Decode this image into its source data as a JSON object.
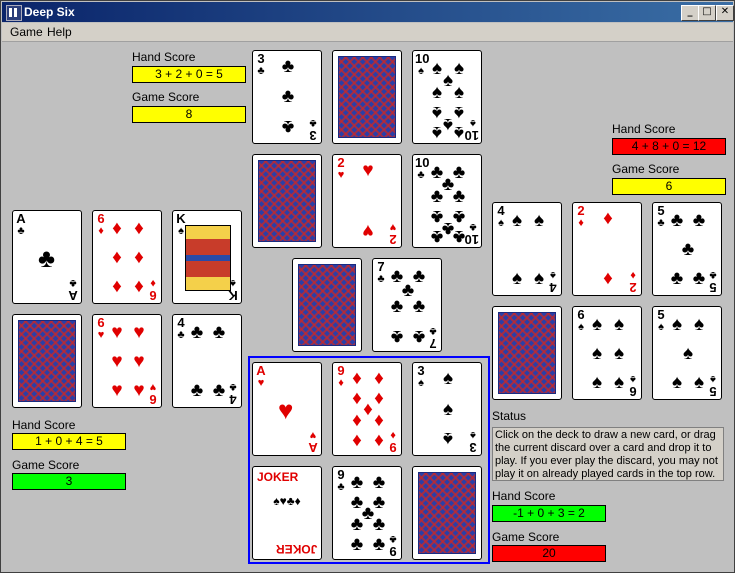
{
  "window": {
    "title": "Deep Six"
  },
  "menu": {
    "game": "Game",
    "help": "Help"
  },
  "buttons": {
    "minimize": "_",
    "maximize": "□",
    "close": "✕"
  },
  "player_top": {
    "hand_label": "Hand Score",
    "hand_value": "3 + 2 + 0 = 5",
    "game_label": "Game Score",
    "game_value": "8"
  },
  "player_right": {
    "hand_label": "Hand Score",
    "hand_value": "4 + 8 + 0 = 12",
    "game_label": "Game Score",
    "game_value": "6"
  },
  "player_left": {
    "hand_label": "Hand Score",
    "hand_value": "1 + 0 + 4 = 5",
    "game_label": "Game Score",
    "game_value": "3"
  },
  "player_bottom": {
    "hand_label": "Hand Score",
    "hand_value": "-1 + 0 + 3 = 2",
    "game_label": "Game Score",
    "game_value": "20"
  },
  "status": {
    "label": "Status",
    "text": "Click on the deck to draw a new card, or drag the current discard over a card and drop it to play. If you ever play the discard, you may not play it on already played cards in the top row."
  },
  "cards": {
    "top_1": {
      "rank": "3",
      "suit": "♣"
    },
    "top_3": {
      "rank": "10",
      "suit": "♠"
    },
    "mid_2": {
      "rank": "2",
      "suit": "♥"
    },
    "mid_3": {
      "rank": "10",
      "suit": "♣"
    },
    "center_2": {
      "rank": "7",
      "suit": "♣"
    },
    "left_1": {
      "rank": "A",
      "suit": "♣"
    },
    "left_2": {
      "rank": "6",
      "suit": "♦"
    },
    "left_3": {
      "rank": "K",
      "suit": "♠"
    },
    "left_5": {
      "rank": "6",
      "suit": "♥"
    },
    "left_6": {
      "rank": "4",
      "suit": "♣"
    },
    "right_1": {
      "rank": "4",
      "suit": "♠"
    },
    "right_2": {
      "rank": "2",
      "suit": "♦"
    },
    "right_3": {
      "rank": "5",
      "suit": "♣"
    },
    "right_5": {
      "rank": "6",
      "suit": "♠"
    },
    "right_6": {
      "rank": "5",
      "suit": "♠"
    },
    "bottom_1": {
      "rank": "A",
      "suit": "♥"
    },
    "bottom_2": {
      "rank": "9",
      "suit": "♦"
    },
    "bottom_3": {
      "rank": "3",
      "suit": "♠"
    },
    "bottom_4": {
      "rank": "JOKER",
      "suit": "♠♥♣♦"
    },
    "bottom_5": {
      "rank": "9",
      "suit": "♣"
    }
  }
}
